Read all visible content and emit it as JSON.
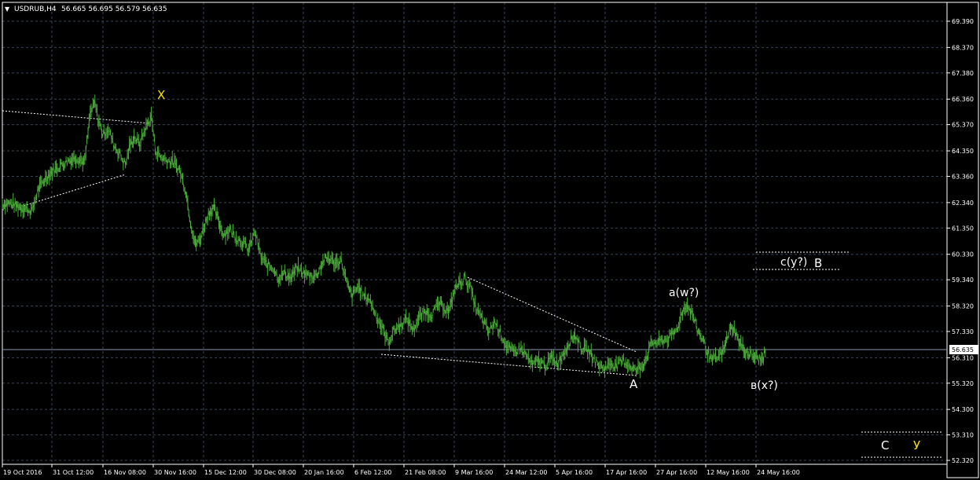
{
  "header": {
    "symbol": "USDRUB,H4",
    "ohlc": "56.665 56.695 56.579 56.635"
  },
  "colors": {
    "background": "#000000",
    "grid": "#34465c",
    "candle": "#4caf3a",
    "price_line": "#8a9bb0",
    "axis_text": "#ffffff",
    "annotation_white": "#ffffff",
    "annotation_yellow": "#ffdd00"
  },
  "chart_data": {
    "type": "line",
    "title": "USDRUB,H4",
    "current_price": "56.635",
    "y_ticks": [
      "69.390",
      "68.370",
      "67.380",
      "66.360",
      "65.370",
      "64.350",
      "63.360",
      "62.340",
      "61.350",
      "60.330",
      "59.340",
      "58.320",
      "57.330",
      "56.310",
      "55.320",
      "54.300",
      "53.310",
      "52.320"
    ],
    "x_ticks": [
      "19 Oct 2016",
      "31 Oct 12:00",
      "16 Nov 08:00",
      "30 Nov 16:00",
      "15 Dec 12:00",
      "30 Dec 08:00",
      "20 Jan 16:00",
      "6 Feb 12:00",
      "21 Feb 08:00",
      "9 Mar 16:00",
      "24 Mar 12:00",
      "5 Apr 16:00",
      "17 Apr 16:00",
      "27 Apr 16:00",
      "12 May 16:00",
      "24 May 16:00"
    ],
    "ylim": [
      51.9,
      69.9
    ],
    "grid": true,
    "series": [
      {
        "values": [
          [
            0,
            62.3
          ],
          [
            10,
            62.3
          ],
          [
            20,
            62.2
          ],
          [
            30,
            62.1
          ],
          [
            38,
            62.0
          ],
          [
            45,
            62.8
          ],
          [
            55,
            63.3
          ],
          [
            65,
            63.6
          ],
          [
            75,
            63.8
          ],
          [
            85,
            64.0
          ],
          [
            95,
            64.1
          ],
          [
            105,
            63.9
          ],
          [
            112,
            65.8
          ],
          [
            118,
            66.2
          ],
          [
            122,
            65.6
          ],
          [
            128,
            65.0
          ],
          [
            135,
            65.2
          ],
          [
            142,
            64.6
          ],
          [
            150,
            64.2
          ],
          [
            157,
            63.8
          ],
          [
            162,
            64.5
          ],
          [
            168,
            64.9
          ],
          [
            175,
            64.6
          ],
          [
            182,
            65.2
          ],
          [
            190,
            65.7
          ],
          [
            195,
            64.4
          ],
          [
            202,
            64.1
          ],
          [
            210,
            64.0
          ],
          [
            218,
            63.9
          ],
          [
            226,
            63.6
          ],
          [
            234,
            62.8
          ],
          [
            240,
            61.6
          ],
          [
            246,
            60.7
          ],
          [
            252,
            60.9
          ],
          [
            258,
            61.5
          ],
          [
            264,
            62.0
          ],
          [
            270,
            62.1
          ],
          [
            276,
            61.6
          ],
          [
            282,
            61.1
          ],
          [
            290,
            61.3
          ],
          [
            298,
            61.0
          ],
          [
            306,
            60.8
          ],
          [
            314,
            60.5
          ],
          [
            322,
            61.2
          ],
          [
            330,
            60.2
          ],
          [
            338,
            59.9
          ],
          [
            346,
            59.8
          ],
          [
            352,
            59.4
          ],
          [
            360,
            59.6
          ],
          [
            368,
            59.4
          ],
          [
            376,
            59.8
          ],
          [
            384,
            59.6
          ],
          [
            392,
            59.5
          ],
          [
            400,
            59.5
          ],
          [
            410,
            60.1
          ],
          [
            416,
            60.2
          ],
          [
            424,
            60.0
          ],
          [
            432,
            60.1
          ],
          [
            440,
            59.1
          ],
          [
            446,
            58.7
          ],
          [
            454,
            59.1
          ],
          [
            460,
            58.7
          ],
          [
            468,
            58.6
          ],
          [
            476,
            58.0
          ],
          [
            484,
            57.5
          ],
          [
            492,
            56.9
          ],
          [
            500,
            57.4
          ],
          [
            508,
            57.6
          ],
          [
            516,
            57.8
          ],
          [
            524,
            57.4
          ],
          [
            532,
            57.9
          ],
          [
            540,
            58.1
          ],
          [
            548,
            58.0
          ],
          [
            556,
            58.4
          ],
          [
            562,
            58.3
          ],
          [
            570,
            58.1
          ],
          [
            576,
            58.9
          ],
          [
            582,
            59.2
          ],
          [
            590,
            59.4
          ],
          [
            597,
            59.0
          ],
          [
            604,
            58.2
          ],
          [
            612,
            57.8
          ],
          [
            620,
            57.3
          ],
          [
            628,
            57.7
          ],
          [
            636,
            57.2
          ],
          [
            644,
            56.7
          ],
          [
            652,
            56.5
          ],
          [
            660,
            56.7
          ],
          [
            668,
            56.4
          ],
          [
            676,
            56.0
          ],
          [
            684,
            56.2
          ],
          [
            692,
            56.0
          ],
          [
            700,
            56.3
          ],
          [
            708,
            56.1
          ],
          [
            716,
            56.5
          ],
          [
            724,
            57.0
          ],
          [
            730,
            57.2
          ],
          [
            738,
            56.7
          ],
          [
            746,
            56.6
          ],
          [
            752,
            56.4
          ],
          [
            760,
            56.0
          ],
          [
            768,
            55.9
          ],
          [
            776,
            56.1
          ],
          [
            784,
            56.0
          ],
          [
            792,
            56.2
          ],
          [
            800,
            56.0
          ],
          [
            808,
            55.8
          ],
          [
            816,
            56.0
          ],
          [
            822,
            56.4
          ],
          [
            828,
            56.9
          ],
          [
            836,
            56.9
          ],
          [
            844,
            57.0
          ],
          [
            852,
            57.1
          ],
          [
            860,
            57.4
          ],
          [
            866,
            58.0
          ],
          [
            872,
            58.4
          ],
          [
            880,
            58.0
          ],
          [
            886,
            57.4
          ],
          [
            892,
            57.1
          ],
          [
            898,
            56.6
          ],
          [
            904,
            56.2
          ],
          [
            912,
            56.3
          ],
          [
            920,
            56.6
          ],
          [
            926,
            57.3
          ],
          [
            932,
            57.5
          ],
          [
            938,
            57.0
          ],
          [
            944,
            56.7
          ],
          [
            950,
            56.5
          ],
          [
            956,
            56.4
          ],
          [
            962,
            56.3
          ],
          [
            968,
            56.2
          ],
          [
            974,
            56.6
          ]
        ]
      }
    ],
    "annotations": {
      "x_label": "X",
      "a_label": "A",
      "aw_label": "a(w?)",
      "bx_label": "в(x?)",
      "cy_label": "c(y?)",
      "b_label": "B",
      "c_label": "C",
      "y_label": "У"
    }
  }
}
